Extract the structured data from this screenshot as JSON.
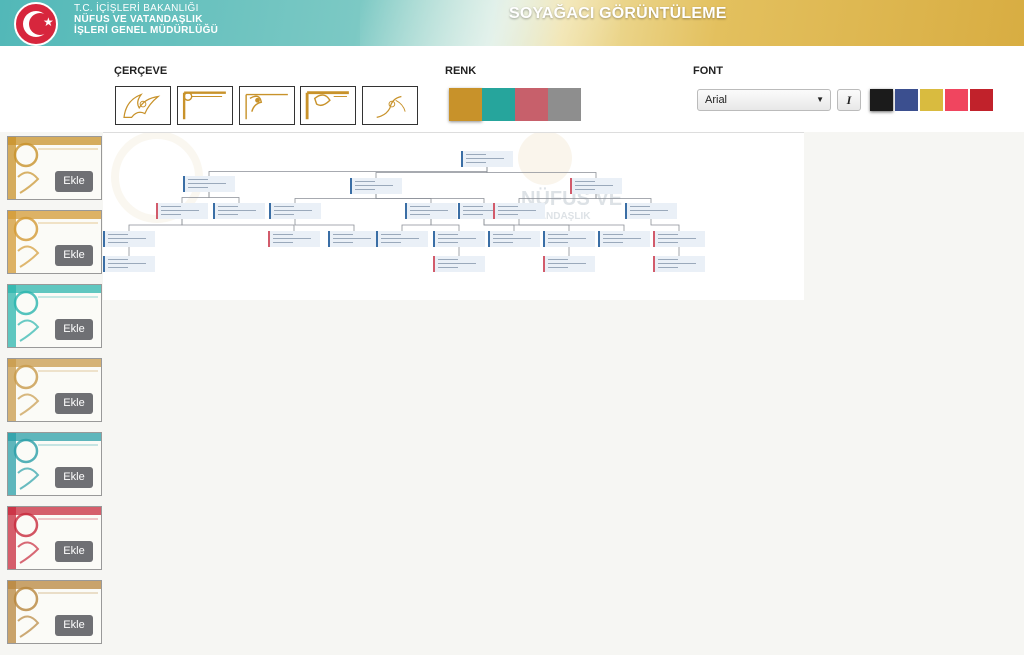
{
  "header": {
    "ministry_line1": "T.C. İÇİŞLERİ BAKANLIĞI",
    "ministry_line2": "NÜFUS VE VATANDAŞLIK",
    "ministry_line3": "İŞLERİ GENEL MÜDÜRLÜĞÜ",
    "title": "SOYAĞACI GÖRÜNTÜLEME"
  },
  "toolbar": {
    "frame_label": "ÇERÇEVE",
    "color_label": "RENK",
    "font_label": "FONT",
    "font_value": "Arial",
    "italic_label": "I",
    "frame_colors": [
      "#c8922a",
      "#26a59c",
      "#c7606b",
      "#8e8e8e"
    ],
    "selected_frame_color": "#c8922a",
    "font_colors": [
      "#1b1b1b",
      "#3b4f8f",
      "#d9bb3f",
      "#f0455f",
      "#c1222b"
    ],
    "selected_font_color": "#1b1b1b"
  },
  "templates": [
    {
      "button": "Ekle",
      "color": "#c8922a"
    },
    {
      "button": "Ekle",
      "color": "#d39a34"
    },
    {
      "button": "Ekle",
      "color": "#2bb5ae"
    },
    {
      "button": "Ekle",
      "color": "#c89a4a"
    },
    {
      "button": "Ekle",
      "color": "#2a9fa8"
    },
    {
      "button": "Ekle",
      "color": "#c82a3c"
    },
    {
      "button": "Ekle",
      "color": "#b8863c"
    }
  ],
  "canvas": {
    "watermark_line1": "NÜFUS VE",
    "watermark_line2": "VATANDAŞLIK"
  }
}
